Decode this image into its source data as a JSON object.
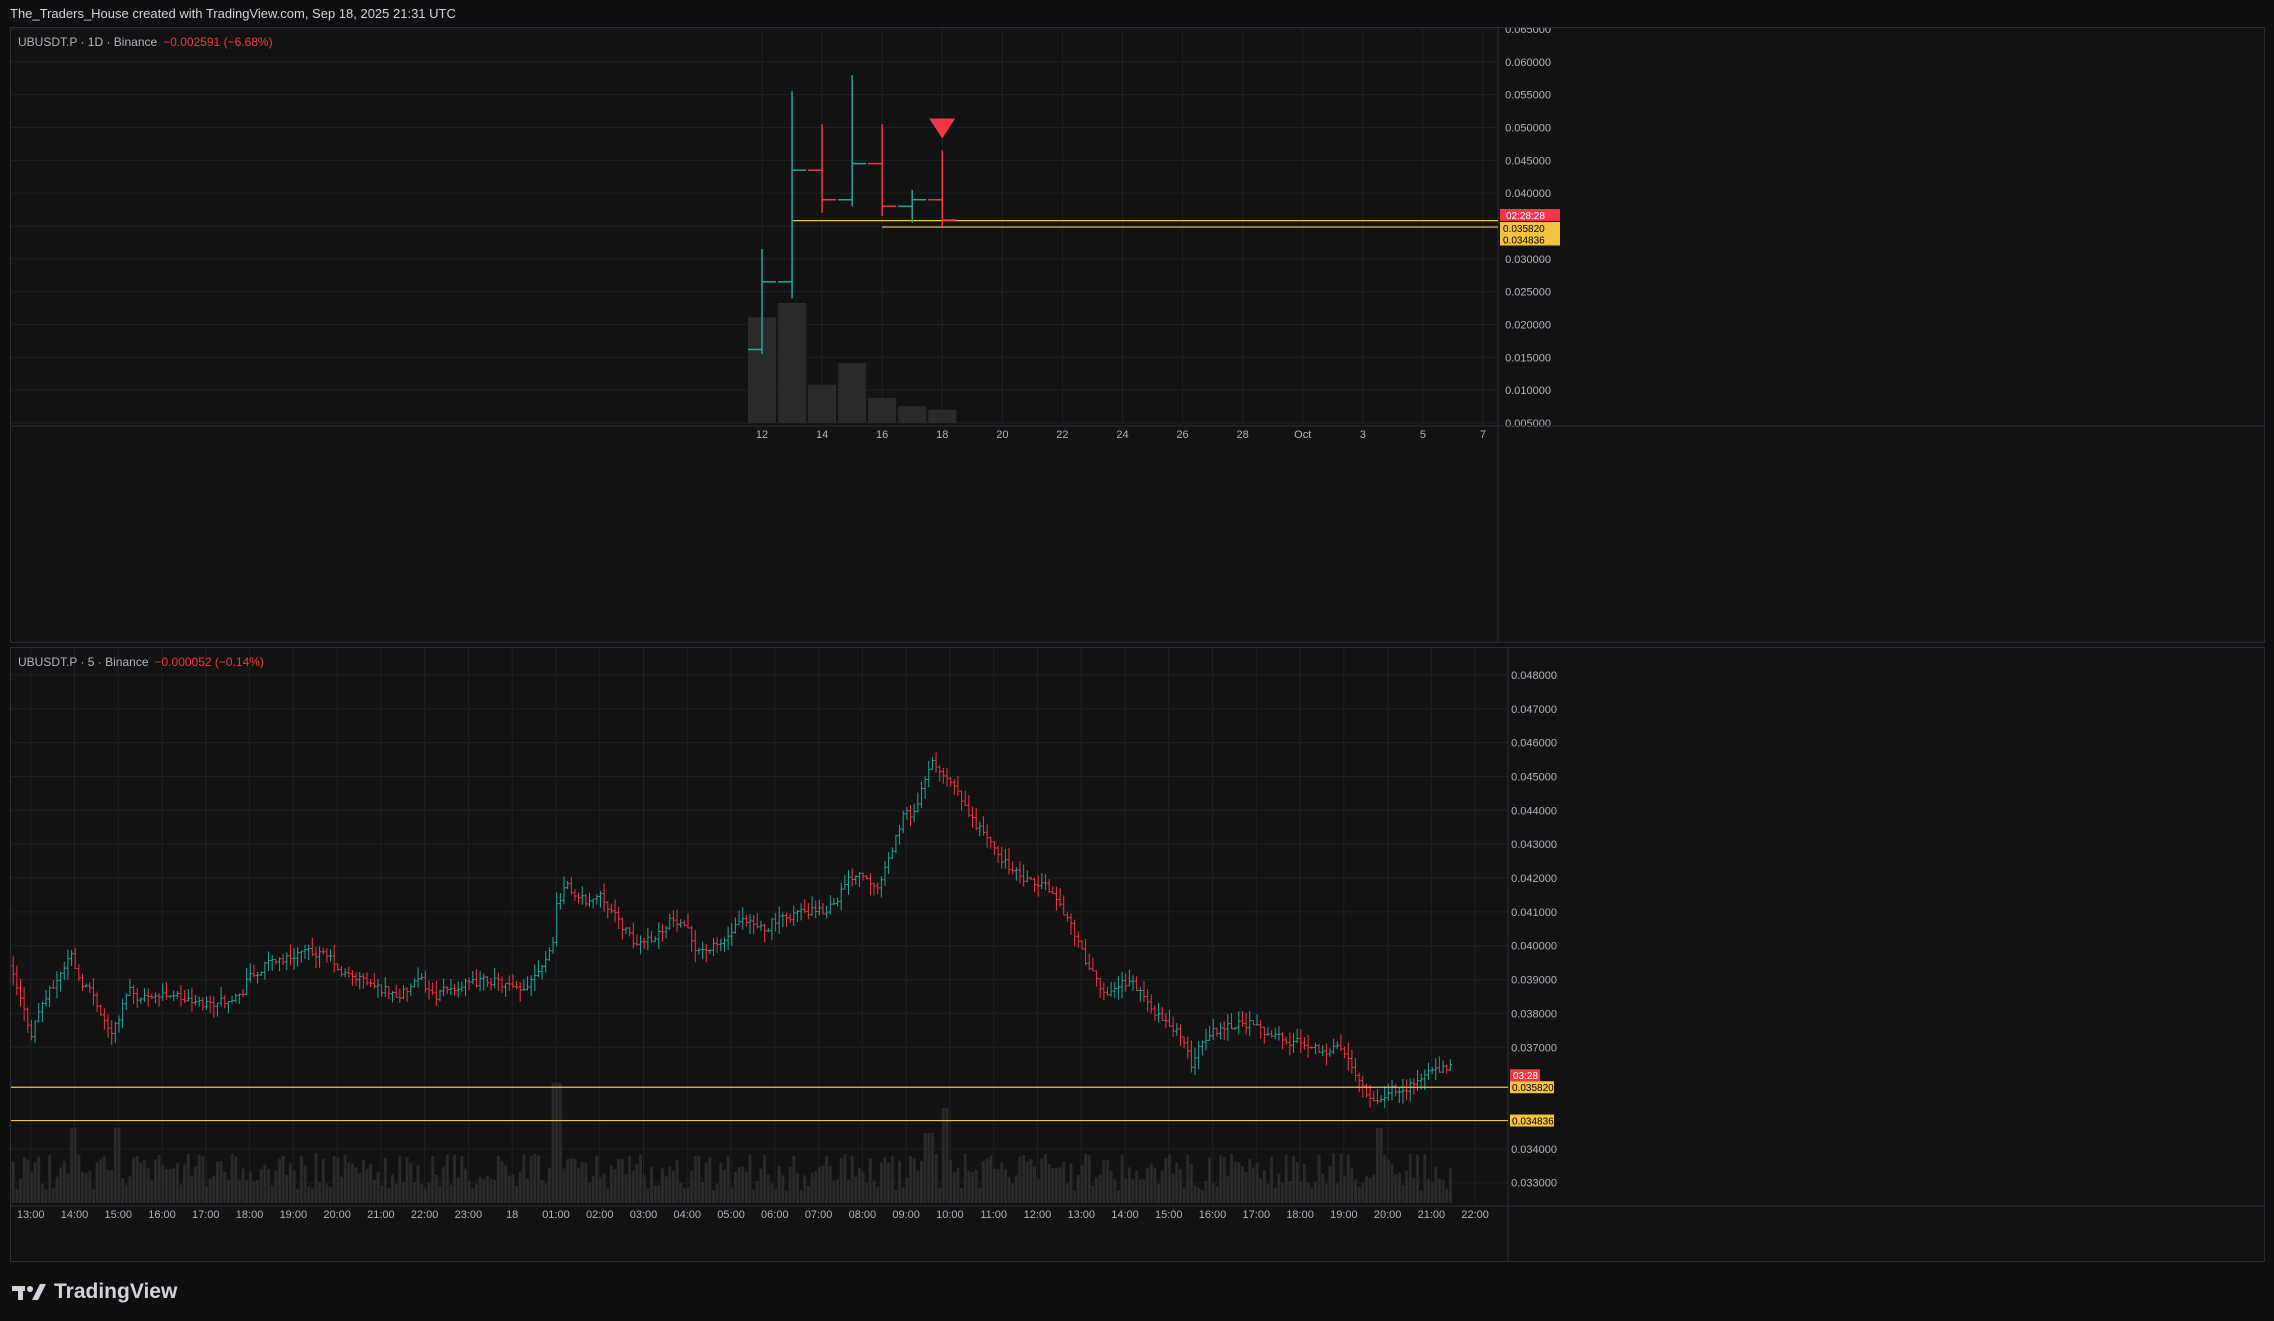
{
  "header": {
    "title": "The_Traders_House created with TradingView.com, Sep 18, 2025 21:31 UTC"
  },
  "footer": {
    "brand": "TradingView"
  },
  "colors": {
    "up": "#26a69a",
    "down": "#f23645",
    "level": "#f5c242",
    "grid": "#1e2027",
    "volume": "#2a2a2a",
    "axisText": "#b2b5be"
  },
  "panes": [
    {
      "legend": {
        "symbol": "UBUSDT.P · 1D · Binance",
        "change": "−0.002591 (−6.68%)"
      }
    },
    {
      "legend": {
        "symbol": "UBUSDT.P · 5 · Binance",
        "change": "−0.000052 (−0.14%)"
      }
    }
  ],
  "chart_data": [
    {
      "type": "ohlc",
      "title": "UBUSDT.P · 1D · Binance",
      "interval": "1D",
      "ylim": [
        0.005,
        0.065
      ],
      "y_ticks": [
        "0.065000",
        "0.060000",
        "0.055000",
        "0.050000",
        "0.045000",
        "0.040000",
        "0.035000",
        "0.030000",
        "0.025000",
        "0.020000",
        "0.015000",
        "0.010000",
        "0.005000"
      ],
      "y_tick_values": [
        0.065,
        0.06,
        0.055,
        0.05,
        0.045,
        0.04,
        0.035,
        0.03,
        0.025,
        0.02,
        0.015,
        0.01,
        0.005
      ],
      "x_ticks": [
        "12",
        "14",
        "16",
        "18",
        "20",
        "22",
        "24",
        "26",
        "28",
        "Oct",
        "3",
        "5",
        "7"
      ],
      "x_tick_days": [
        12,
        14,
        16,
        18,
        20,
        22,
        24,
        26,
        28,
        30,
        32,
        34,
        36
      ],
      "x_range_days": [
        -13,
        36.5
      ],
      "bars": [
        {
          "day": 12,
          "open": 0.0162,
          "high": 0.0315,
          "low": 0.0155,
          "close": 0.0265,
          "volume": 0.88
        },
        {
          "day": 13,
          "open": 0.0265,
          "high": 0.0555,
          "low": 0.024,
          "close": 0.0435,
          "volume": 1.0
        },
        {
          "day": 14,
          "open": 0.0435,
          "high": 0.0505,
          "low": 0.037,
          "close": 0.039,
          "volume": 0.32
        },
        {
          "day": 15,
          "open": 0.039,
          "high": 0.058,
          "low": 0.038,
          "close": 0.0445,
          "volume": 0.5
        },
        {
          "day": 16,
          "open": 0.0445,
          "high": 0.0505,
          "low": 0.0365,
          "close": 0.038,
          "volume": 0.21
        },
        {
          "day": 17,
          "open": 0.038,
          "high": 0.0405,
          "low": 0.0355,
          "close": 0.039,
          "volume": 0.14
        },
        {
          "day": 18,
          "open": 0.039,
          "high": 0.0465,
          "low": 0.035,
          "close": 0.0359,
          "volume": 0.11
        }
      ],
      "markers": [
        {
          "day": 18,
          "price": 0.05,
          "shape": "triangle-down",
          "color": "#f23645"
        }
      ],
      "levels": [
        {
          "price": 0.03582,
          "from_day": 13,
          "label": "0.035820"
        },
        {
          "price": 0.034836,
          "from_day": 16,
          "label": "0.034836"
        }
      ],
      "countdown": "02:28:28"
    },
    {
      "type": "ohlc",
      "title": "UBUSDT.P · 5 · Binance",
      "interval": "5",
      "ylim": [
        0.0324,
        0.0485
      ],
      "y_ticks": [
        "0.048000",
        "0.047000",
        "0.046000",
        "0.045000",
        "0.044000",
        "0.043000",
        "0.042000",
        "0.041000",
        "0.040000",
        "0.039000",
        "0.038000",
        "0.037000",
        "0.034000",
        "0.033000"
      ],
      "y_tick_values": [
        0.048,
        0.047,
        0.046,
        0.045,
        0.044,
        0.043,
        0.042,
        0.041,
        0.04,
        0.039,
        0.038,
        0.037,
        0.034,
        0.033
      ],
      "x_ticks": [
        "13:00",
        "14:00",
        "15:00",
        "16:00",
        "17:00",
        "18:00",
        "19:00",
        "20:00",
        "21:00",
        "22:00",
        "23:00",
        "18",
        "01:00",
        "02:00",
        "03:00",
        "04:00",
        "05:00",
        "06:00",
        "07:00",
        "08:00",
        "09:00",
        "10:00",
        "11:00",
        "12:00",
        "13:00",
        "14:00",
        "15:00",
        "16:00",
        "17:00",
        "18:00",
        "19:00",
        "20:00",
        "21:00",
        "22:00"
      ],
      "x_tick_hours": [
        13,
        14,
        15,
        16,
        17,
        18,
        19,
        20,
        21,
        22,
        23,
        24,
        25,
        26,
        27,
        28,
        29,
        30,
        31,
        32,
        33,
        34,
        35,
        36,
        37,
        38,
        39,
        40,
        41,
        42,
        43,
        44,
        45,
        46
      ],
      "x_range_hours": [
        12.55,
        46.75
      ],
      "path_start_hour": 12.6,
      "path_end_hour": 45.5,
      "path": [
        [
          12.6,
          0.0394
        ],
        [
          12.9,
          0.0382
        ],
        [
          13.1,
          0.0374
        ],
        [
          13.3,
          0.0382
        ],
        [
          13.6,
          0.0388
        ],
        [
          13.9,
          0.0395
        ],
        [
          14.0,
          0.0398
        ],
        [
          14.2,
          0.039
        ],
        [
          14.5,
          0.0386
        ],
        [
          14.7,
          0.038
        ],
        [
          14.9,
          0.0374
        ],
        [
          15.1,
          0.0378
        ],
        [
          15.3,
          0.0388
        ],
        [
          15.6,
          0.0384
        ],
        [
          15.8,
          0.0386
        ],
        [
          16.0,
          0.0385
        ],
        [
          16.3,
          0.0386
        ],
        [
          16.6,
          0.0384
        ],
        [
          16.9,
          0.0383
        ],
        [
          17.2,
          0.0383
        ],
        [
          17.5,
          0.0384
        ],
        [
          17.7,
          0.0385
        ],
        [
          17.9,
          0.0385
        ],
        [
          18.0,
          0.039
        ],
        [
          18.3,
          0.0392
        ],
        [
          18.6,
          0.0396
        ],
        [
          18.9,
          0.0396
        ],
        [
          19.2,
          0.0398
        ],
        [
          19.5,
          0.0398
        ],
        [
          19.8,
          0.0397
        ],
        [
          20.0,
          0.0396
        ],
        [
          20.1,
          0.0392
        ],
        [
          20.4,
          0.0391
        ],
        [
          20.7,
          0.039
        ],
        [
          20.9,
          0.0388
        ],
        [
          21.2,
          0.0387
        ],
        [
          21.5,
          0.0385
        ],
        [
          21.8,
          0.0388
        ],
        [
          22.0,
          0.039
        ],
        [
          22.3,
          0.0385
        ],
        [
          22.6,
          0.0387
        ],
        [
          22.9,
          0.0388
        ],
        [
          23.2,
          0.0389
        ],
        [
          23.5,
          0.039
        ],
        [
          23.8,
          0.0389
        ],
        [
          24.0,
          0.0388
        ],
        [
          24.3,
          0.0386
        ],
        [
          24.6,
          0.0392
        ],
        [
          24.8,
          0.0395
        ],
        [
          25.0,
          0.04
        ],
        [
          25.1,
          0.0412
        ],
        [
          25.3,
          0.0418
        ],
        [
          25.6,
          0.0414
        ],
        [
          25.9,
          0.0413
        ],
        [
          26.1,
          0.0416
        ],
        [
          26.3,
          0.0411
        ],
        [
          26.6,
          0.0406
        ],
        [
          26.9,
          0.04
        ],
        [
          27.1,
          0.0402
        ],
        [
          27.4,
          0.0403
        ],
        [
          27.7,
          0.0408
        ],
        [
          27.9,
          0.0406
        ],
        [
          28.1,
          0.0404
        ],
        [
          28.3,
          0.0399
        ],
        [
          28.6,
          0.0399
        ],
        [
          28.9,
          0.0401
        ],
        [
          29.1,
          0.0404
        ],
        [
          29.3,
          0.0407
        ],
        [
          29.6,
          0.0406
        ],
        [
          29.9,
          0.0405
        ],
        [
          30.0,
          0.0407
        ],
        [
          30.3,
          0.0408
        ],
        [
          30.6,
          0.041
        ],
        [
          30.9,
          0.041
        ],
        [
          31.2,
          0.041
        ],
        [
          31.5,
          0.0414
        ],
        [
          31.8,
          0.042
        ],
        [
          32.0,
          0.0422
        ],
        [
          32.3,
          0.0419
        ],
        [
          32.5,
          0.0418
        ],
        [
          32.8,
          0.043
        ],
        [
          33.0,
          0.0438
        ],
        [
          33.3,
          0.044
        ],
        [
          33.5,
          0.0448
        ],
        [
          33.7,
          0.0455
        ],
        [
          33.9,
          0.045
        ],
        [
          34.1,
          0.0448
        ],
        [
          34.3,
          0.0444
        ],
        [
          34.6,
          0.0437
        ],
        [
          34.9,
          0.0433
        ],
        [
          35.1,
          0.0428
        ],
        [
          35.4,
          0.0424
        ],
        [
          35.7,
          0.042
        ],
        [
          36.0,
          0.0418
        ],
        [
          36.3,
          0.0418
        ],
        [
          36.6,
          0.0412
        ],
        [
          36.9,
          0.0405
        ],
        [
          37.1,
          0.0398
        ],
        [
          37.4,
          0.039
        ],
        [
          37.6,
          0.0386
        ],
        [
          37.9,
          0.0388
        ],
        [
          38.2,
          0.039
        ],
        [
          38.5,
          0.0385
        ],
        [
          38.8,
          0.038
        ],
        [
          39.0,
          0.0377
        ],
        [
          39.3,
          0.0375
        ],
        [
          39.6,
          0.0365
        ],
        [
          39.8,
          0.0371
        ],
        [
          40.0,
          0.0374
        ],
        [
          40.3,
          0.0376
        ],
        [
          40.6,
          0.0377
        ],
        [
          40.9,
          0.0377
        ],
        [
          41.2,
          0.0375
        ],
        [
          41.5,
          0.0374
        ],
        [
          41.8,
          0.0371
        ],
        [
          42.1,
          0.0372
        ],
        [
          42.4,
          0.037
        ],
        [
          42.7,
          0.0369
        ],
        [
          43.0,
          0.037
        ],
        [
          43.3,
          0.0364
        ],
        [
          43.6,
          0.0357
        ],
        [
          43.8,
          0.0354
        ],
        [
          44.0,
          0.0356
        ],
        [
          44.3,
          0.0358
        ],
        [
          44.5,
          0.0358
        ],
        [
          44.8,
          0.036
        ],
        [
          45.0,
          0.0363
        ],
        [
          45.3,
          0.0363
        ],
        [
          45.5,
          0.0364
        ]
      ],
      "volume_spikes": [
        [
          25.0,
          1.0
        ],
        [
          33.9,
          0.75
        ],
        [
          33.5,
          0.5
        ],
        [
          43.8,
          0.55
        ],
        [
          14.0,
          0.55
        ],
        [
          15.0,
          0.55
        ]
      ],
      "levels": [
        {
          "price": 0.03582,
          "label": "0.035820"
        },
        {
          "price": 0.034836,
          "label": "0.034836"
        }
      ],
      "countdown": "03:28"
    }
  ]
}
